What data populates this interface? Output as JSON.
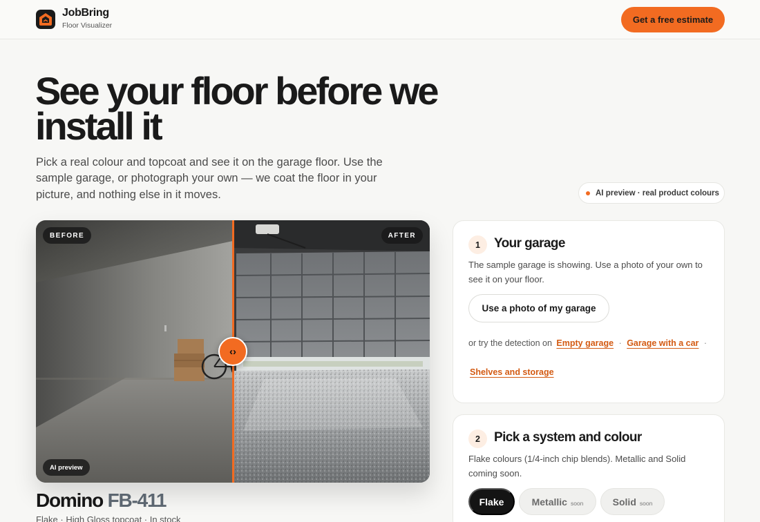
{
  "brand": {
    "name": "JobBring",
    "tagline": "Floor Visualizer",
    "accent": "#f26b21"
  },
  "header": {
    "cta_label": "Get a free estimate"
  },
  "hero": {
    "title": "See your floor before we install it",
    "description": "Pick a real colour and topcoat and see it on the garage floor. Use the sample garage, or photograph your own — we coat the floor in your picture, and nothing else in it moves.",
    "ai_pill": "AI preview · real product colours"
  },
  "compare": {
    "before_label": "BEFORE",
    "after_label": "AFTER",
    "ai_label": "AI preview",
    "handle_glyph": "‹›",
    "handle_icon": "chevron-left-right-icon",
    "slider_position_fraction": 0.5
  },
  "product": {
    "name": "Domino",
    "code": "FB-411",
    "meta": "Flake · High Gloss topcoat · In stock"
  },
  "step1": {
    "number": "1",
    "title": "Your garage",
    "description": "The sample garage is showing. Use a photo of your own to see it on your floor.",
    "button_label": "Use a photo of my garage",
    "detect_prefix": "or try the detection on",
    "options": [
      "Empty garage",
      "Garage with a car",
      "Shelves and storage"
    ],
    "separator": "·"
  },
  "step2": {
    "number": "2",
    "title": "Pick a system and colour",
    "description": "Flake colours (1/4-inch chip blends). Metallic and Solid coming soon.",
    "systems": [
      {
        "label": "Flake",
        "selected": true,
        "tag": ""
      },
      {
        "label": "Metallic",
        "selected": false,
        "tag": "soon"
      },
      {
        "label": "Solid",
        "selected": false,
        "tag": "soon"
      }
    ]
  }
}
